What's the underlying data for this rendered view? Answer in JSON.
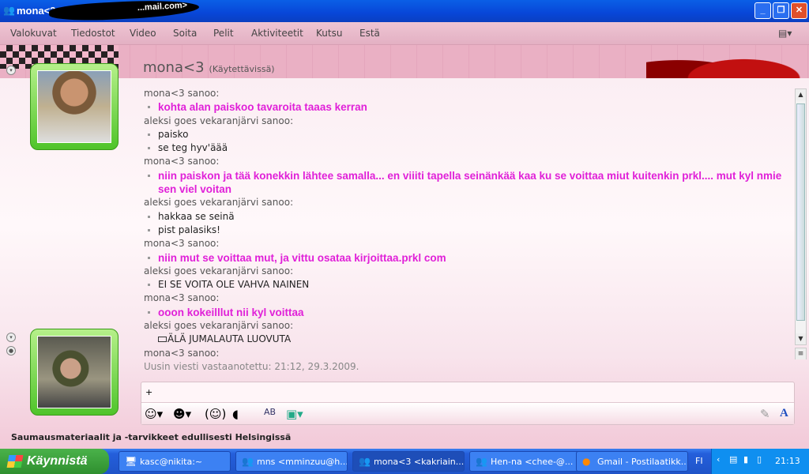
{
  "window": {
    "title": "mona<3",
    "title_suffix": "...mail.com>",
    "buttons": {
      "minimize": "_",
      "maximize": "❐",
      "close": "✕"
    }
  },
  "menu": [
    "Valokuvat",
    "Tiedostot",
    "Video",
    "Soita",
    "Pelit",
    "Aktiviteetit",
    "Kutsu",
    "Estä"
  ],
  "contact": {
    "name": "mona<3",
    "status": "(Käytettävissä)"
  },
  "messages": [
    {
      "sender": "mona<3 sanoo:",
      "bold": true,
      "lines": [
        "kohta alan paiskoo tavaroita taaas kerran"
      ]
    },
    {
      "sender": "aleksi goes vekaranjärvi sanoo:",
      "bold": false,
      "lines": [
        "paisko",
        "se teg hyv'äää"
      ]
    },
    {
      "sender": "mona<3 sanoo:",
      "bold": true,
      "lines": [
        "niin paiskon ja tää konekkin lähtee samalla... en viiiti tapella seinänkää kaa ku se voittaa miut kuitenkin prkl.... mut kyl nmie sen viel voitan"
      ]
    },
    {
      "sender": "aleksi goes vekaranjärvi sanoo:",
      "bold": false,
      "lines": [
        "hakkaa se seinä",
        "pist palasiks!"
      ]
    },
    {
      "sender": "mona<3 sanoo:",
      "bold": true,
      "lines": [
        "niin mut se voittaa mut, ja vittu osataa kirjoittaa.prkl com"
      ]
    },
    {
      "sender": "aleksi goes vekaranjärvi sanoo:",
      "bold": false,
      "lines": [
        "EI SE VOITA OLE VAHVA NAINEN"
      ]
    },
    {
      "sender": "mona<3 sanoo:",
      "bold": true,
      "lines": [
        "ooon kokeilllut nii kyl voittaa"
      ]
    },
    {
      "sender": "aleksi goes vekaranjärvi sanoo:",
      "bold": false,
      "nobullet": true,
      "lines": [
        "ÄLÄ JUMALAUTA LUOVUTA"
      ]
    },
    {
      "sender": "mona<3 sanoo:",
      "bold": false,
      "lines": []
    }
  ],
  "last_message_status": "Uusin viesti vastaanotettu: 21:12, 29.3.2009.",
  "input": {
    "value": "+"
  },
  "ad_text": "Saumausmateriaalit ja -tarvikkeet edullisesti Helsingissä",
  "taskbar": {
    "start": "Käynnistä",
    "items": [
      "kasc@nikita:~",
      "mns <mminzuu@h...",
      "mona<3 <kakriain...",
      "Hen-na <chee-@...",
      "Gmail - Postilaatikk..."
    ],
    "active": 2,
    "lang": "FI",
    "clock": "21:13"
  }
}
